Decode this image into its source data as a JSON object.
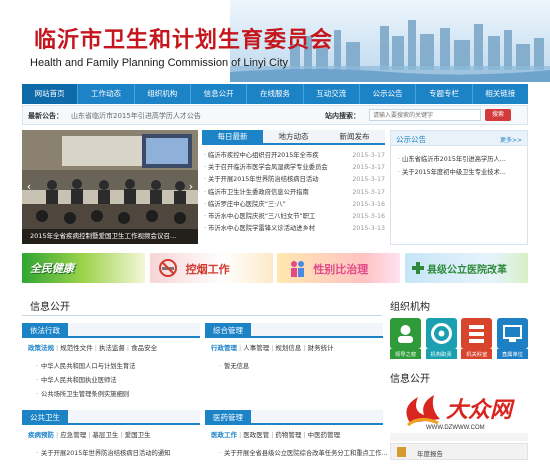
{
  "header": {
    "title": "临沂市卫生和计划生育委员会",
    "subtitle": "Health and Family Planning Commission of Linyi City"
  },
  "nav": {
    "items": [
      "网站首页",
      "工作动态",
      "组织机构",
      "信息公开",
      "在线服务",
      "互动交流",
      "公示公告",
      "专题专栏",
      "相关链接"
    ]
  },
  "newsbar": {
    "label": "最新公告：",
    "text": "山东省临沂市2015年引进高学历人才公告",
    "search_label": "站内搜索：",
    "search_placeholder": "请输入要搜索的关键字",
    "search_button": "搜索"
  },
  "photo": {
    "caption": "2015年全省疾病控制暨爱国卫生工作视频会议召..."
  },
  "news": {
    "tabs": [
      "每日最新",
      "地方动态",
      "新闻发布"
    ],
    "items": [
      {
        "title": "临沂市疾控中心组织召开2015年全市疾",
        "date": "2015-3-17"
      },
      {
        "title": "关于召开临沂市医学会风湿病学专业委员会",
        "date": "2015-3-17"
      },
      {
        "title": "关于开展2015年世界防治结核病日活动",
        "date": "2015-3-17"
      },
      {
        "title": "临沂市卫生计生委政府信息公开指南",
        "date": "2015-3-17"
      },
      {
        "title": "临沂罗庄中心医院庆“三·八”",
        "date": "2015-3-16"
      },
      {
        "title": "市沂水中心医院庆祝“三八妇女节”职工",
        "date": "2015-3-16"
      },
      {
        "title": "市沂水中心医院学雷锋义诊活动进乡村",
        "date": "2015-3-13"
      }
    ]
  },
  "notice": {
    "title": "公示公告",
    "more": "更多>>",
    "items": [
      "山东省临沂市2015年引进高学历人...",
      "关于2015年度初中级卫生专业技术..."
    ]
  },
  "banners": [
    "全民健康",
    "控烟工作",
    "性别比治理",
    "县级公立医院改革"
  ],
  "info": {
    "title": "信息公开",
    "panels": [
      {
        "tab": "依法行政",
        "subs": [
          "政策法规",
          "规范性文件",
          "执法监督",
          "食品安全"
        ],
        "items": [
          "中华人民共和国人口与计划生育法",
          "中华人民共和国执业医师法",
          "公共场所卫生管理条例实施细则"
        ]
      },
      {
        "tab": "综合管理",
        "subs": [
          "行政管理",
          "人事管理",
          "规划信息",
          "财务统计"
        ],
        "items": [
          "暂无信息"
        ]
      },
      {
        "tab": "公共卫生",
        "subs": [
          "疾病预防",
          "应急管理",
          "基层卫生",
          "爱国卫生"
        ],
        "items": [
          "关于开展2015年世界防治结核病日活动的通知"
        ]
      },
      {
        "tab": "医药管理",
        "subs": [
          "医政工作",
          "医政医管",
          "药物管理",
          "中医药管理"
        ],
        "items": [
          "关于开展全省县级公立医院综合改革任务分工和重点工作..."
        ]
      }
    ]
  },
  "org": {
    "title": "组织机构",
    "items": [
      {
        "label": "领导之窗",
        "color": "#2e9a3a"
      },
      {
        "label": "机构职责",
        "color": "#1aa0b0"
      },
      {
        "label": "机关科室",
        "color": "#d8442c"
      },
      {
        "label": "直属单位",
        "color": "#1d7fc4"
      }
    ]
  },
  "info2": {
    "title": "信息公开",
    "dzw_name": "大众网",
    "dzw_url": "WWW.DZWWW.COM",
    "year_report": "年度报告"
  }
}
